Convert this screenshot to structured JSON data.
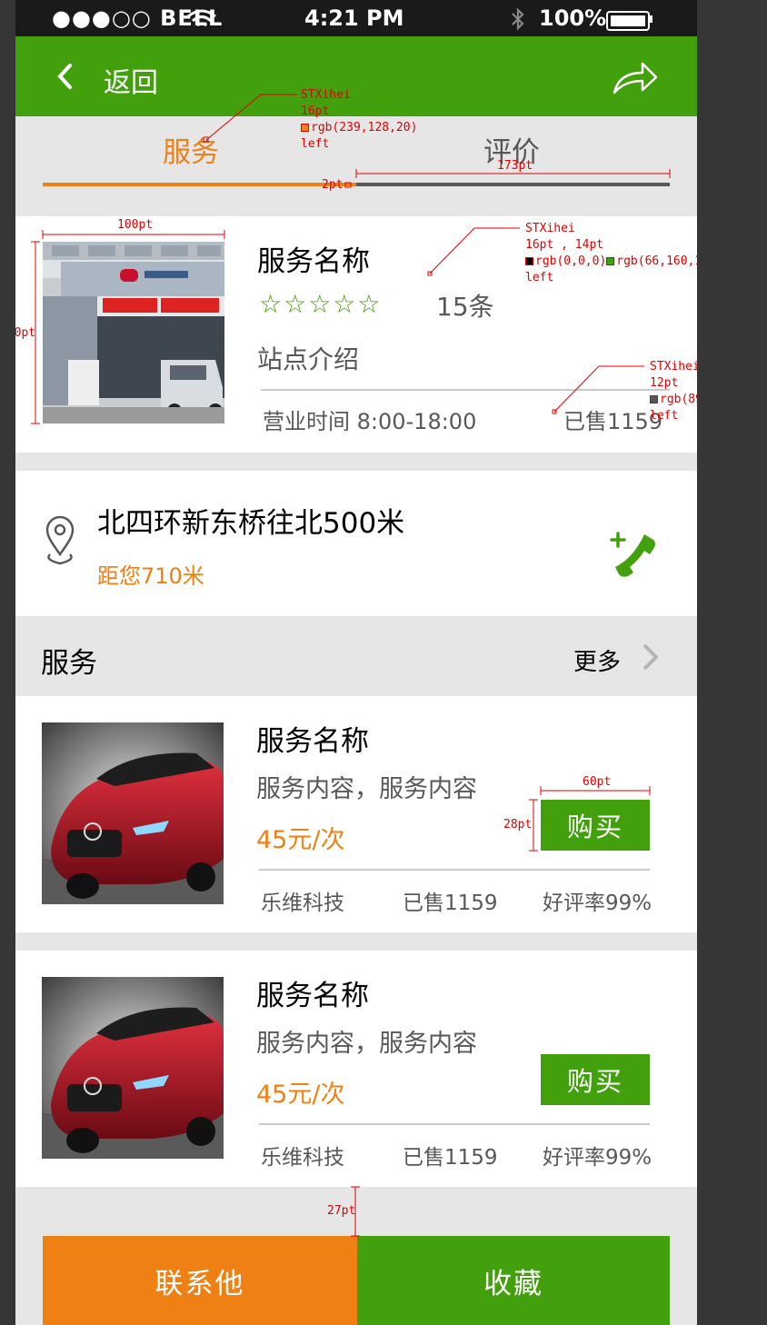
{
  "status_bar": {
    "carrier": "●●●○○ BELL",
    "time": "4:21 PM",
    "battery": "100%"
  },
  "nav": {
    "back_label": "返回"
  },
  "tabs": [
    {
      "label": "服务",
      "active": true
    },
    {
      "label": "评价",
      "active": false
    }
  ],
  "store": {
    "name": "服务名称",
    "stars": "☆☆☆☆☆",
    "review_count": "15条",
    "intro": "站点介绍",
    "hours": "营业时间 8:00-18:00",
    "sold": "已售1159"
  },
  "address": {
    "text": "北四环新东桥往北500米",
    "distance": "距您710米"
  },
  "services_section": {
    "title": "服务",
    "more_label": "更多"
  },
  "services": [
    {
      "name": "服务名称",
      "desc": "服务内容，服务内容",
      "price": "45元/次",
      "buy_label": "购买",
      "vendor": "乐维科技",
      "sold": "已售1159",
      "rating": "好评率99%"
    },
    {
      "name": "服务名称",
      "desc": "服务内容，服务内容",
      "price": "45元/次",
      "buy_label": "购买",
      "vendor": "乐维科技",
      "sold": "已售1159",
      "rating": "好评率99%"
    }
  ],
  "bottom_bar": {
    "contact_label": "联系他",
    "favorite_label": "收藏"
  },
  "annotations": {
    "tab_font": {
      "font": "STXihei",
      "size": "16pt",
      "color": "rgb(239,128,20)",
      "align": "left"
    },
    "tab_width": "173pt",
    "tab_gap": "2pt",
    "img_width": "100pt",
    "img_height": "100pt",
    "store_font": {
      "font": "STXihei",
      "size": "16pt , 14pt",
      "color1": "rgb(0,0,0)",
      "color2": "rgb(66,160,10)",
      "color3": "rgb(89,87,87)",
      "align": "left"
    },
    "small_font": {
      "font": "STXihei",
      "size": "12pt",
      "color": "rgb(89,87,87)",
      "align": "left"
    },
    "btn_width": "60pt",
    "btn_height": "28pt",
    "gap_height": "27pt"
  },
  "colors": {
    "brand_green": "#42a00c",
    "accent_orange": "rgb(239,128,20)",
    "text_gray": "rgb(89,87,87)"
  }
}
